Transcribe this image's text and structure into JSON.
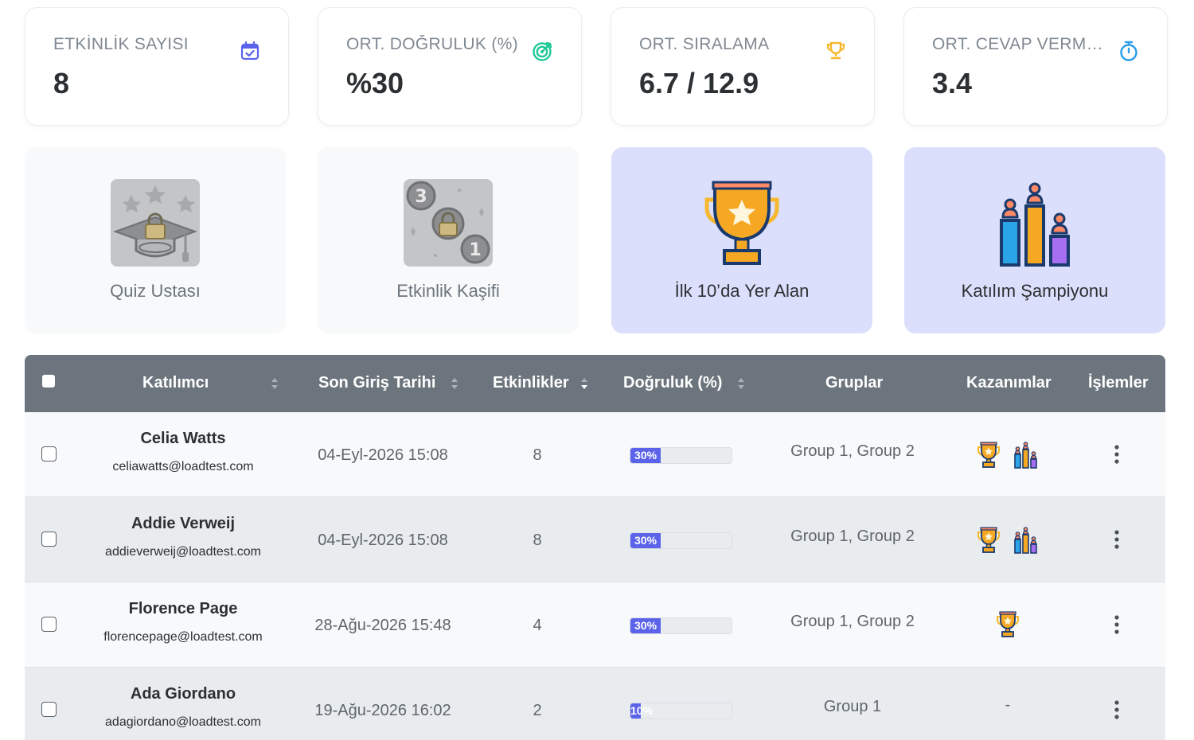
{
  "stats": [
    {
      "label": "ETKİNLİK SAYISI",
      "value": "8",
      "icon": "calendar-check-icon",
      "color": "#5b63ea"
    },
    {
      "label": "ORT. DOĞRULUK (%)",
      "value": "%30",
      "icon": "target-icon",
      "color": "#20c997"
    },
    {
      "label": "ORT. SIRALAMA",
      "value": "6.7 / 12.9",
      "icon": "trophy-icon",
      "color": "#f5b82e"
    },
    {
      "label": "ORT. CEVAP VERME SÜRESİ",
      "value": "3.4",
      "icon": "stopwatch-icon",
      "color": "#2a9ce8"
    }
  ],
  "badges": [
    {
      "name": "Quiz Ustası",
      "earned": false,
      "icon": "graduation-cap-locked-icon"
    },
    {
      "name": "Etkinlik Kaşifi",
      "earned": false,
      "icon": "medals-locked-icon"
    },
    {
      "name": "İlk 10’da Yer Alan",
      "earned": true,
      "icon": "gold-trophy-icon"
    },
    {
      "name": "Katılım Şampiyonu",
      "earned": true,
      "icon": "podium-icon"
    }
  ],
  "table": {
    "headers": {
      "participant": "Katılımcı",
      "last_login": "Son Giriş Tarihi",
      "activities": "Etkinlikler",
      "accuracy": "Doğruluk (%)",
      "groups": "Gruplar",
      "achievements": "Kazanımlar",
      "actions": "İşlemler"
    },
    "rows": [
      {
        "name": "Celia Watts",
        "email": "celiawatts@loadtest.com",
        "last_login": "04-Eyl-2026 15:08",
        "activities": "8",
        "accuracy_label": "30%",
        "accuracy": 30,
        "groups": "Group 1, Group 2",
        "achievements": [
          "trophy",
          "podium"
        ],
        "no_achievement": ""
      },
      {
        "name": "Addie Verweij",
        "email": "addieverweij@loadtest.com",
        "last_login": "04-Eyl-2026 15:08",
        "activities": "8",
        "accuracy_label": "30%",
        "accuracy": 30,
        "groups": "Group 1, Group 2",
        "achievements": [
          "trophy",
          "podium"
        ],
        "no_achievement": ""
      },
      {
        "name": "Florence Page",
        "email": "florencepage@loadtest.com",
        "last_login": "28-Ağu-2026 15:48",
        "activities": "4",
        "accuracy_label": "30%",
        "accuracy": 30,
        "groups": "Group 1, Group 2",
        "achievements": [
          "trophy"
        ],
        "no_achievement": ""
      },
      {
        "name": "Ada Giordano",
        "email": "adagiordano@loadtest.com",
        "last_login": "19-Ağu-2026 16:02",
        "activities": "2",
        "accuracy_label": "10%",
        "accuracy": 10,
        "groups": "Group 1",
        "achievements": [],
        "no_achievement": "-"
      }
    ]
  }
}
